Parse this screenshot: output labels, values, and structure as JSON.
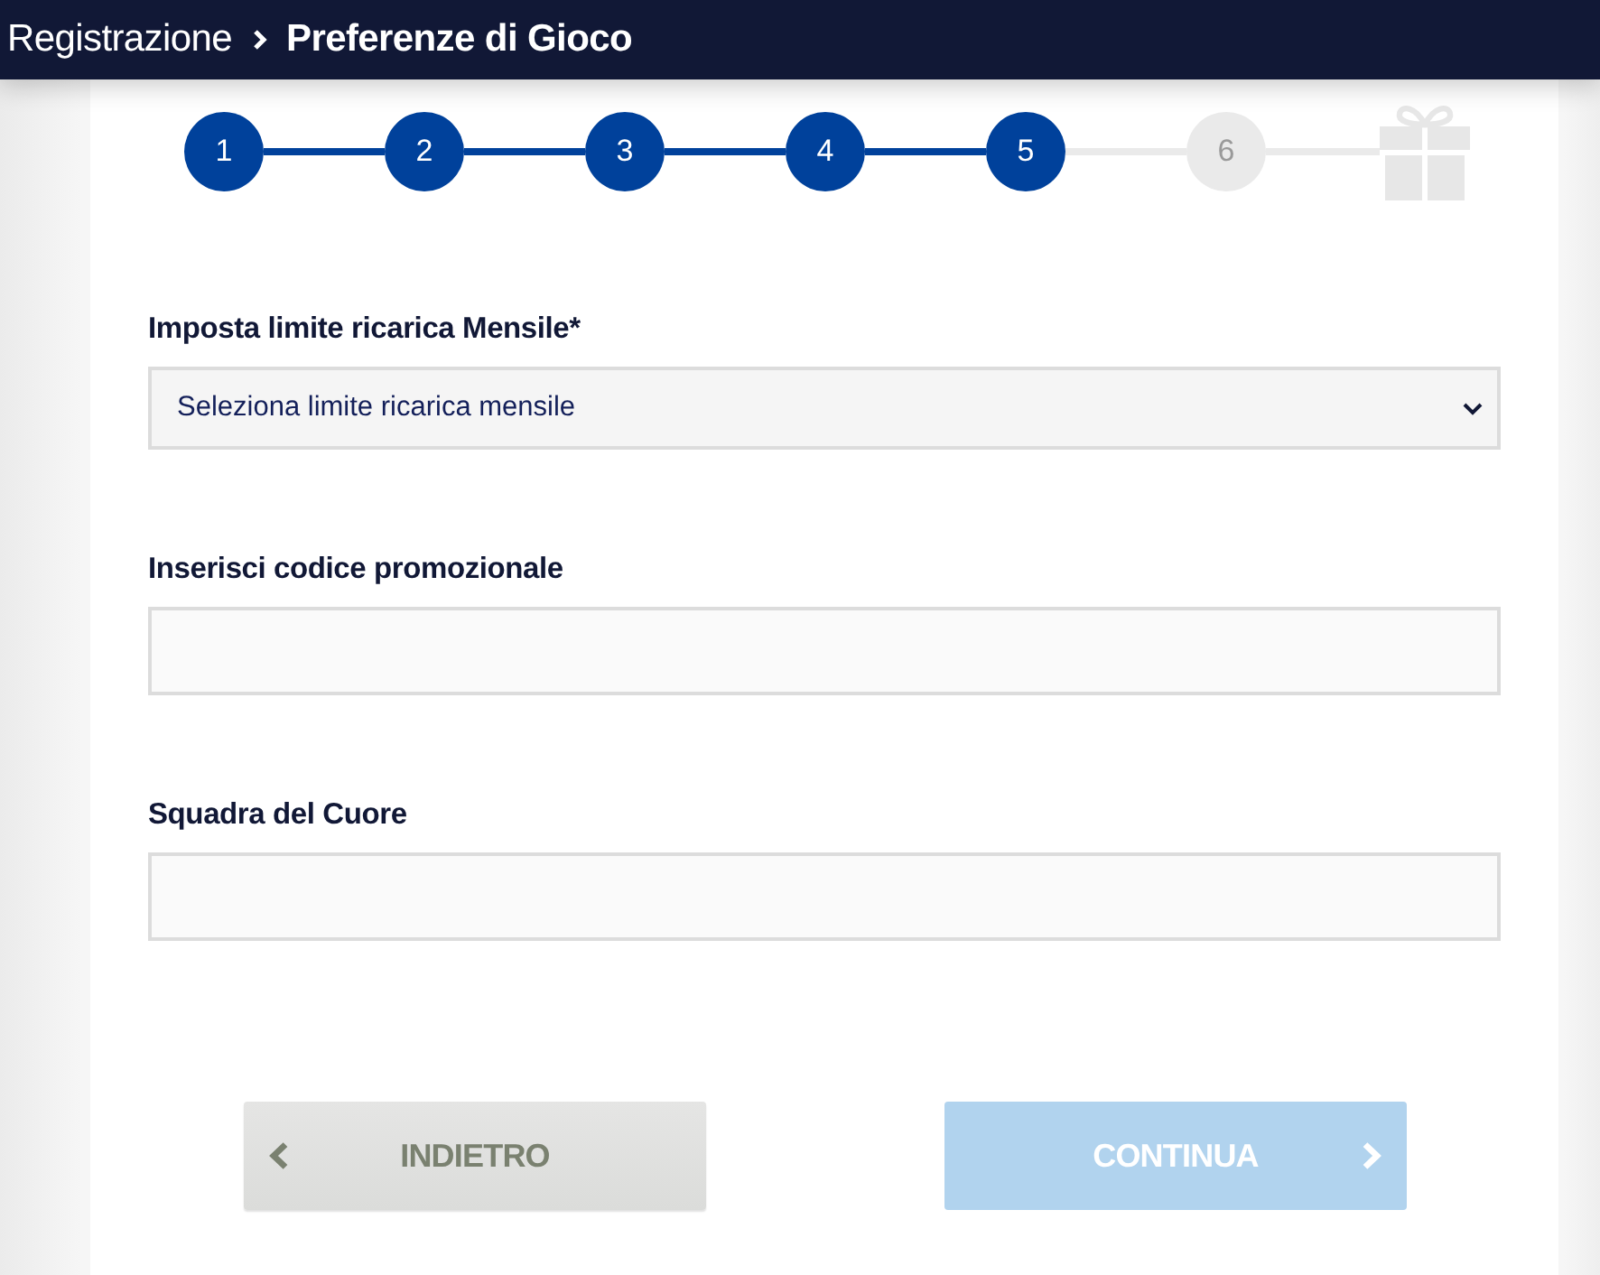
{
  "header": {
    "breadcrumb": [
      {
        "label": "Registrazione",
        "current": false
      },
      {
        "label": "Preferenze di Gioco",
        "current": true
      }
    ]
  },
  "stepper": {
    "steps": [
      {
        "label": "1",
        "completed": true
      },
      {
        "label": "2",
        "completed": true
      },
      {
        "label": "3",
        "completed": true
      },
      {
        "label": "4",
        "completed": true
      },
      {
        "label": "5",
        "completed": true
      },
      {
        "label": "6",
        "completed": false
      }
    ]
  },
  "form": {
    "fields": [
      {
        "kind": "select",
        "label": "Imposta limite ricarica Mensile*",
        "value": "Seleziona limite ricarica mensile"
      },
      {
        "kind": "text",
        "label": "Inserisci codice promozionale"
      },
      {
        "kind": "text",
        "label": "Squadra del Cuore"
      }
    ]
  },
  "buttons": [
    {
      "kind": "back",
      "label": "INDIETRO",
      "disabled": false
    },
    {
      "kind": "next",
      "label": "CONTINUA",
      "disabled": true
    }
  ]
}
